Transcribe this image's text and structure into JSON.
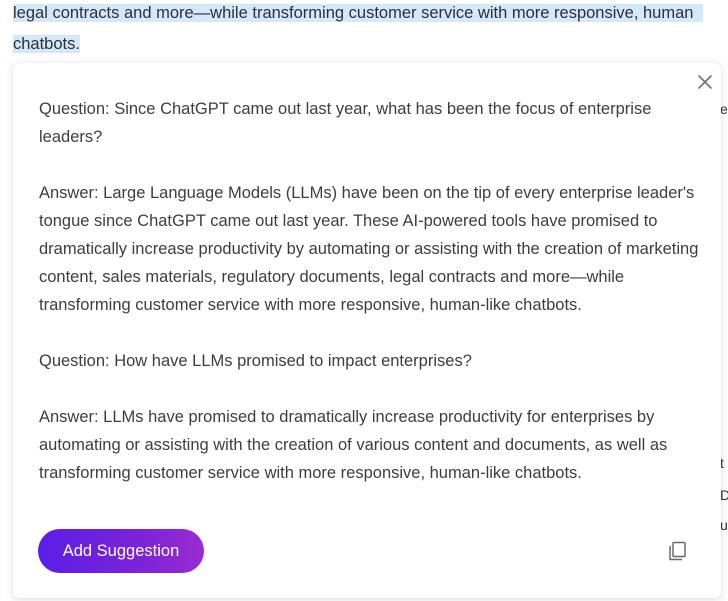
{
  "document": {
    "line1": "legal contracts and more—while transforming customer service with more responsive, human",
    "line2": "chatbots.",
    "margin_glyphs": [
      "e",
      "t",
      "D",
      "u"
    ]
  },
  "popup": {
    "paragraphs": [
      "Question: Since ChatGPT came out last year, what has been the focus of enterprise leaders?",
      "Answer: Large Language Models (LLMs) have been on the tip of every enterprise leader's tongue since ChatGPT came out last year. These AI-powered tools have promised to dramatically increase productivity by automating or assisting with the creation of marketing content, sales materials, regulatory documents, legal contracts and more—while transforming customer service with more responsive, human-like chatbots.",
      "Question: How have LLMs promised to impact enterprises?",
      "Answer: LLMs have promised to dramatically increase productivity for enterprises by automating or assisting with the creation of various content and documents, as well as transforming customer service with more responsive, human-like chatbots."
    ],
    "add_button_label": "Add Suggestion",
    "close_icon": "close-icon",
    "copy_icon": "copy-icon"
  },
  "colors": {
    "highlight": "#d3e9fb",
    "button_gradient_start": "#5b1ee6",
    "button_gradient_end": "#9a2bd0"
  }
}
